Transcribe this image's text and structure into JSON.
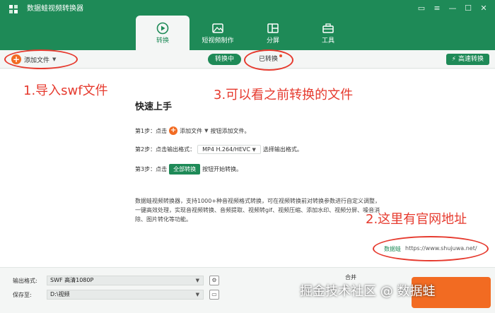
{
  "app": {
    "title": "数据蛙视频转换器"
  },
  "tabs": [
    {
      "label": "转换",
      "icon": "convert-icon"
    },
    {
      "label": "短视频制作",
      "icon": "image-icon"
    },
    {
      "label": "分屏",
      "icon": "split-screen-icon"
    },
    {
      "label": "工具",
      "icon": "toolbox-icon"
    }
  ],
  "toolbar": {
    "add_file": "添加文件",
    "converting": "转换中",
    "converted": "已转换",
    "fast_convert": "高速转换"
  },
  "annotations": {
    "a1": "1.导入swf文件",
    "a3": "3.可以看之前转换的文件",
    "a2": "2.这里有官网地址"
  },
  "quick_start": {
    "title": "快速上手",
    "step1_prefix": "第1步：点击",
    "step1_button": "添加文件",
    "step1_suffix": "按钮添加文件。",
    "step2_prefix": "第2步：点击输出格式：",
    "step2_format": "MP4 H.264/HEVC",
    "step2_suffix": "选择输出格式。",
    "step3_prefix": "第3步：点击",
    "step3_button": "全部转换",
    "step3_suffix": "按钮开始转换。"
  },
  "description": "数据蛙视频转换器，支持1000+种音视频格式转换，可在视频转换前对转换参数进行自定义调整，一键高效处理，实现音视频转换、音频提取、视频转gif、视频压缩、添加水印、视频分屏、噪音消除、图片转化等功能。",
  "site": {
    "brand": "数据蛙",
    "url": "https://www.shujuwa.net/"
  },
  "bottom": {
    "output_format_label": "输出格式:",
    "output_format_value": "SWF 高清1080P",
    "save_to_label": "保存至:",
    "save_to_value": "D:\\视频",
    "merge_label": "合并"
  },
  "watermark": "掘金技术社区 @ 数据蛙",
  "colors": {
    "brand_green": "#1e8a57",
    "accent_orange": "#f26b22",
    "annotation_red": "#e63a2e"
  }
}
